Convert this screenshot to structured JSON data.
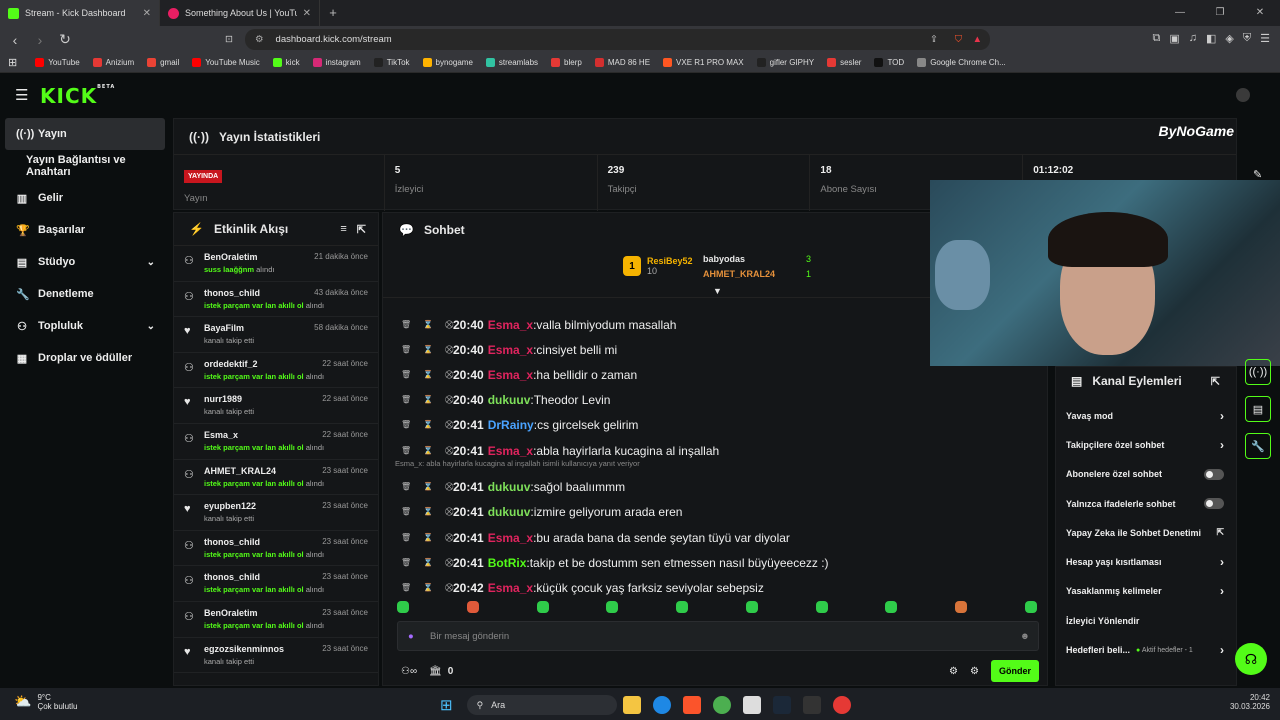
{
  "browser": {
    "tabs": [
      {
        "title": "Stream - Kick Dashboard",
        "active": true,
        "color": "#53fc18"
      },
      {
        "title": "Something About Us | YouTube M",
        "active": false,
        "color": "#e91e63"
      }
    ],
    "url": "dashboard.kick.com/stream",
    "bookmarks": [
      {
        "label": "YouTube",
        "color": "#ff0000"
      },
      {
        "label": "Anizium",
        "color": "#e53935"
      },
      {
        "label": "gmail",
        "color": "#ea4335"
      },
      {
        "label": "YouTube Music",
        "color": "#ff0000"
      },
      {
        "label": "kick",
        "color": "#53fc18"
      },
      {
        "label": "instagram",
        "color": "#d62976"
      },
      {
        "label": "TikTok",
        "color": "#222222"
      },
      {
        "label": "bynogame",
        "color": "#ffb300"
      },
      {
        "label": "streamlabs",
        "color": "#31c3a2"
      },
      {
        "label": "blerp",
        "color": "#e53935"
      },
      {
        "label": "MAD 86 HE",
        "color": "#d32f2f"
      },
      {
        "label": "VXE R1 PRO MAX",
        "color": "#ff5722"
      },
      {
        "label": "gifler GIPHY",
        "color": "#222222"
      },
      {
        "label": "sesler",
        "color": "#e53935"
      },
      {
        "label": "TOD",
        "color": "#111111"
      },
      {
        "label": "Google Chrome Ch...",
        "color": "#888888"
      }
    ]
  },
  "brand": {
    "logo": "KICK",
    "beta": "BETA",
    "watermark": "ByNoGame"
  },
  "sidebar": [
    {
      "label": "Yayın",
      "icon": "broadcast-icon",
      "active": true
    },
    {
      "label": "Yayın Bağlantısı ve Anahtarı",
      "icon": "",
      "active": false
    },
    {
      "label": "Gelir",
      "icon": "chart-icon",
      "active": false
    },
    {
      "label": "Başarılar",
      "icon": "trophy-icon",
      "active": false
    },
    {
      "label": "Stüdyo",
      "icon": "studio-icon",
      "active": false,
      "chev": true
    },
    {
      "label": "Denetleme",
      "icon": "wrench-icon",
      "active": false
    },
    {
      "label": "Topluluk",
      "icon": "people-icon",
      "active": false,
      "chev": true
    },
    {
      "label": "Droplar ve ödüller",
      "icon": "drops-icon",
      "active": false
    }
  ],
  "stats": {
    "title": "Yayın İstatistikleri",
    "live_badge": "YAYINDA",
    "live_label": "Yayın",
    "cells": [
      {
        "value": "5",
        "label": "İzleyici"
      },
      {
        "value": "239",
        "label": "Takipçi"
      },
      {
        "value": "18",
        "label": "Abone Sayısı"
      },
      {
        "value": "01:12:02",
        "label": ""
      }
    ]
  },
  "activity": {
    "title": "Etkinlik Akışı",
    "items": [
      {
        "name": "BenOraletim",
        "time": "21 dakika önce",
        "hl": "suss laağğnm",
        "rest": " alındı",
        "icon": "gift"
      },
      {
        "name": "thonos_child",
        "time": "43 dakika önce",
        "hl": "istek parçam var lan akıllı ol",
        "rest": " alındı",
        "icon": "gift"
      },
      {
        "name": "BayaFilm",
        "time": "58 dakika önce",
        "hl": "",
        "rest": "kanalı takip etti",
        "icon": "heart"
      },
      {
        "name": "ordedektif_2",
        "time": "22 saat önce",
        "hl": "istek parçam var lan akıllı ol",
        "rest": " alındı",
        "icon": "gift"
      },
      {
        "name": "nurr1989",
        "time": "22 saat önce",
        "hl": "",
        "rest": "kanalı takip etti",
        "icon": "heart"
      },
      {
        "name": "Esma_x",
        "time": "22 saat önce",
        "hl": "istek parçam var lan akıllı ol",
        "rest": " alındı",
        "icon": "gift"
      },
      {
        "name": "AHMET_KRAL24",
        "time": "23 saat önce",
        "hl": "istek parçam var lan akıllı ol",
        "rest": " alındı",
        "icon": "gift"
      },
      {
        "name": "eyupben122",
        "time": "23 saat önce",
        "hl": "",
        "rest": "kanalı takip etti",
        "icon": "heart"
      },
      {
        "name": "thonos_child",
        "time": "23 saat önce",
        "hl": "istek parçam var lan akıllı ol",
        "rest": " alındı",
        "icon": "gift"
      },
      {
        "name": "thonos_child",
        "time": "23 saat önce",
        "hl": "istek parçam var lan akıllı ol",
        "rest": " alındı",
        "icon": "gift"
      },
      {
        "name": "BenOraletim",
        "time": "23 saat önce",
        "hl": "istek parçam var lan akıllı ol",
        "rest": " alındı",
        "icon": "gift"
      },
      {
        "name": "egzozsikenminnos",
        "time": "23 saat önce",
        "hl": "",
        "rest": "kanalı takip etti",
        "icon": "heart"
      }
    ]
  },
  "chat": {
    "title": "Sohbet",
    "leaders": {
      "top": {
        "name": "ResiBey52",
        "count": "10",
        "rank": "1"
      },
      "others": [
        {
          "name": "babyodas",
          "count": "3"
        },
        {
          "name": "AHMET_KRAL24",
          "count": "1"
        }
      ]
    },
    "messages": [
      {
        "time": "20:40",
        "user": "Esma_x",
        "color": "#e0245e",
        "text": "valla bilmiyodum masallah"
      },
      {
        "time": "20:40",
        "user": "Esma_x",
        "color": "#e0245e",
        "text": "cinsiyet belli mi"
      },
      {
        "time": "20:40",
        "user": "Esma_x",
        "color": "#e0245e",
        "text": "ha bellidir o zaman"
      },
      {
        "time": "20:40",
        "user": "dukuuv",
        "color": "#7ee05a",
        "text": "Theodor Levin"
      },
      {
        "time": "20:41",
        "user": "DrRainy",
        "color": "#4aa3ff",
        "text": "cs gircelsek gelirim"
      },
      {
        "time": "20:41",
        "user": "Esma_x",
        "color": "#e0245e",
        "text": "abla hayirlarla kucagina al inşallah"
      },
      {
        "time": "20:41",
        "user": "dukuuv",
        "color": "#7ee05a",
        "text": "sağol baalıımmm"
      },
      {
        "time": "20:41",
        "user": "dukuuv",
        "color": "#7ee05a",
        "text": "izmire geliyorum arada eren"
      },
      {
        "time": "20:41",
        "user": "Esma_x",
        "color": "#e0245e",
        "text": "bu arada bana da sende şeytan tüyü var diyolar"
      },
      {
        "time": "20:41",
        "user": "BotRix",
        "color": "#53fc18",
        "text": "takip et be dostumm sen etmessen nasıl büyüyeecezz :)"
      },
      {
        "time": "20:42",
        "user": "Esma_x",
        "color": "#e0245e",
        "text": "küçük çocuk yaş farksiz seviyolar sebepsiz"
      }
    ],
    "reply_hint": "Esma_x: abla hayirlarla kucagina al inşallah isimli kullanıcıya yanıt veriyor",
    "placeholder": "Bir mesaj gönderin",
    "points": "0",
    "send": "Gönder"
  },
  "channel_actions": {
    "title": "Kanal Eylemleri",
    "options": [
      {
        "label": "Yavaş mod",
        "ctl": "arrow"
      },
      {
        "label": "Takipçilere özel sohbet",
        "ctl": "arrow"
      },
      {
        "label": "Abonelere özel sohbet",
        "ctl": "toggle"
      },
      {
        "label": "Yalnızca ifadelerle sohbet",
        "ctl": "toggle"
      },
      {
        "label": "Yapay Zeka ile Sohbet Denetimi",
        "ctl": "ext"
      },
      {
        "label": "Hesap yaşı kısıtlaması",
        "ctl": "arrow"
      },
      {
        "label": "Yasaklanmış kelimeler",
        "ctl": "arrow"
      },
      {
        "label": "İzleyici Yönlendir",
        "ctl": "none"
      },
      {
        "label": "Hedefleri beli...",
        "ctl": "goal",
        "extra": "Aktif hedefler - 1"
      }
    ]
  },
  "taskbar": {
    "weather": "9°C",
    "weather_desc": "Çok bulutlu",
    "search": "Ara",
    "time": "20:42",
    "date": "30.03.2026"
  },
  "colors": {
    "accent": "#53fc18",
    "live": "#c8161e"
  }
}
